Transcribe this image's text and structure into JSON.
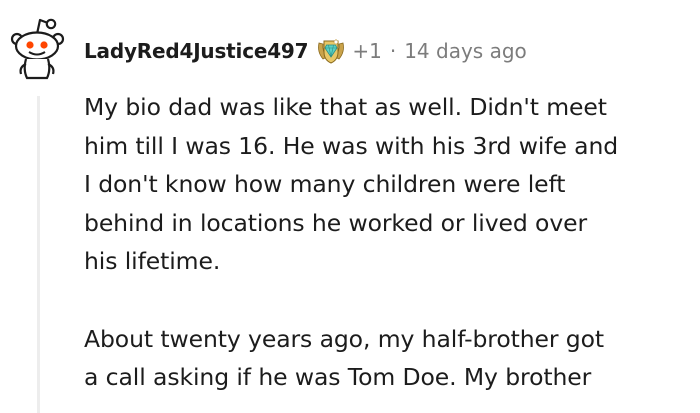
{
  "comment": {
    "username": "LadyRed4Justice497",
    "award_icon": "award-badge-icon",
    "award_count": "+1",
    "separator": "·",
    "timestamp": "14 days ago",
    "paragraphs": [
      {
        "lines": [
          "My bio dad was like that as well. Didn't meet",
          "him till I was 16. He was with his 3rd wife and",
          "I don't know how many children were left",
          "behind in locations he worked or lived over",
          "his lifetime."
        ]
      },
      {
        "lines": [
          "About twenty years ago, my half-brother got",
          "a call asking if he was Tom Doe. My brother"
        ]
      }
    ]
  },
  "colors": {
    "text": "#1c1c1c",
    "meta": "#7c7c7c",
    "avatar_eye": "#ff4500",
    "thread_line": "#ededed"
  }
}
